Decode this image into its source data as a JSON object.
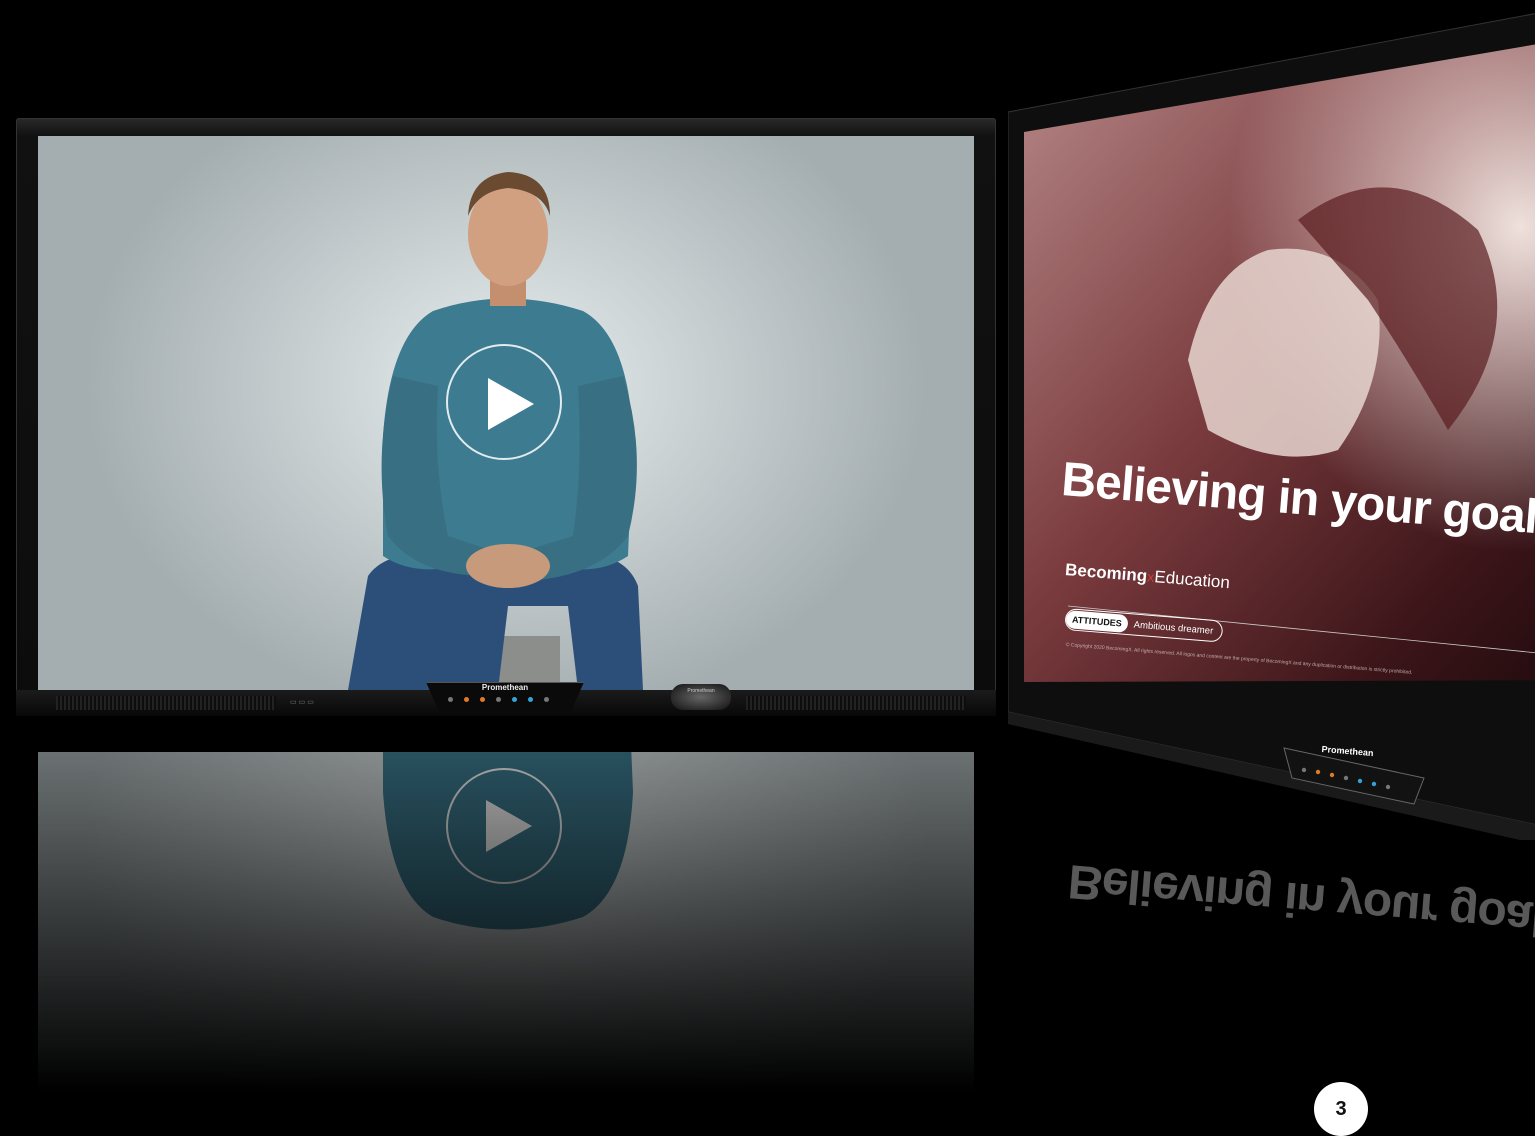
{
  "left_display": {
    "brand": "Promethean",
    "pen_brand": "Promethean",
    "play_button": "play-icon"
  },
  "right_display": {
    "slide_title": "Believing in your goal",
    "brand_bold": "Becoming",
    "brand_mark": "X",
    "brand_light": "Education",
    "pill_tag": "ATTITUDES",
    "pill_value": "Ambitious dreamer",
    "copyright": "© Copyright 2020 BecomingX. All rights reserved. All logos and content are the property of BecomingX and any duplication or distribution is strictly prohibited.",
    "brand": "Promethean"
  },
  "page_number": "3",
  "colors": {
    "background": "#000000",
    "accent_orange": "#e07a24",
    "accent_blue": "#34a3d8",
    "brand_red": "#e23a3a"
  }
}
